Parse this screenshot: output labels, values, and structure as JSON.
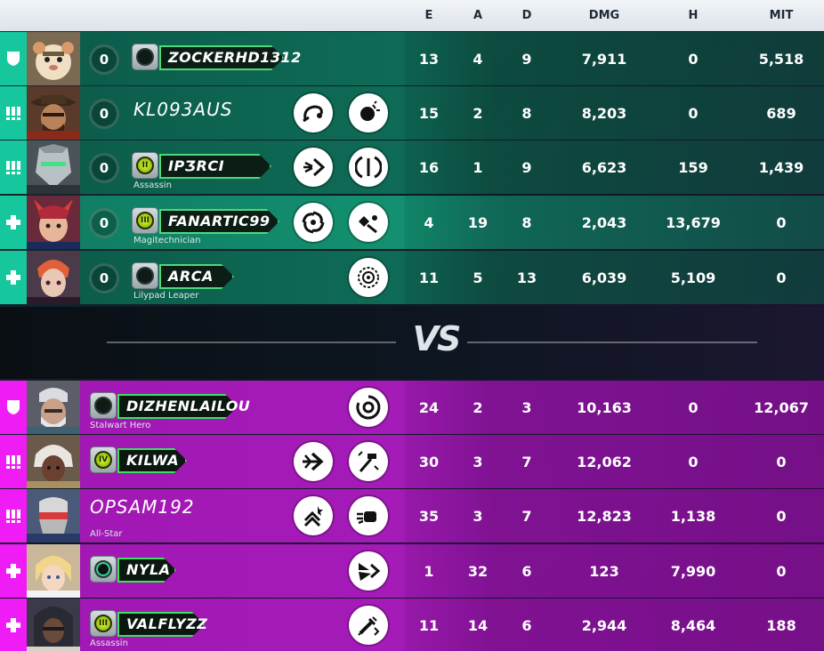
{
  "header": {
    "columns": [
      "E",
      "A",
      "D",
      "DMG",
      "H",
      "MIT"
    ]
  },
  "vs_label": "VS",
  "team_a": [
    {
      "role": "tank",
      "portrait": "hamster-hero-portrait",
      "elims_ring": "0",
      "name": "ZOCKERHD1312",
      "name_style": "nameplate",
      "badge": "empty",
      "title": "",
      "abilities": [],
      "stats": {
        "e": "13",
        "a": "4",
        "d": "9",
        "dmg": "7,911",
        "h": "0",
        "mit": "5,518"
      }
    },
    {
      "role": "damage",
      "portrait": "cowboy-hero-portrait",
      "elims_ring": "0",
      "name": "KL093AUS",
      "name_style": "plain",
      "badge": "",
      "title": "",
      "abilities": [
        "grapple-icon",
        "burst-icon"
      ],
      "stats": {
        "e": "15",
        "a": "2",
        "d": "8",
        "dmg": "8,203",
        "h": "0",
        "mit": "689"
      }
    },
    {
      "role": "damage",
      "portrait": "cyborg-ninja-portrait",
      "elims_ring": "0",
      "name": "IPƷRCI",
      "name_style": "nameplate",
      "badge": "II",
      "title": "Assassin",
      "abilities": [
        "dash-icon",
        "deflect-icon"
      ],
      "stats": {
        "e": "16",
        "a": "1",
        "d": "9",
        "dmg": "6,623",
        "h": "159",
        "mit": "1,439"
      }
    },
    {
      "role": "support",
      "portrait": "fox-mage-portrait",
      "elims_ring": "0",
      "name": "FANARTIC99",
      "name_style": "nameplate",
      "badge": "III",
      "title": "Magitechnician",
      "abilities": [
        "spiral-icon",
        "spirit-icon"
      ],
      "stats": {
        "e": "4",
        "a": "19",
        "d": "8",
        "dmg": "2,043",
        "h": "13,679",
        "mit": "0"
      }
    },
    {
      "role": "support",
      "portrait": "scientist-portrait",
      "elims_ring": "0",
      "name": "ARCA",
      "name_style": "nameplate",
      "badge": "empty",
      "title": "Lilypad Leaper",
      "abilities": [
        "target-orb-icon"
      ],
      "stats": {
        "e": "11",
        "a": "5",
        "d": "13",
        "dmg": "6,039",
        "h": "5,109",
        "mit": "0"
      }
    }
  ],
  "team_b": [
    {
      "role": "tank",
      "portrait": "armored-veteran-portrait",
      "name": "DIZHENLAILOU",
      "name_style": "nameplate",
      "badge": "empty",
      "title": "Stalwart Hero",
      "abilities": [
        "vortex-icon"
      ],
      "stats": {
        "e": "24",
        "a": "2",
        "d": "3",
        "dmg": "10,163",
        "h": "0",
        "mit": "12,067"
      }
    },
    {
      "role": "damage",
      "portrait": "white-hair-hero-portrait",
      "name": "KILWA",
      "name_style": "nameplate",
      "badge": "IV",
      "title": "",
      "abilities": [
        "arrow-dash-icon",
        "hammer-icon"
      ],
      "stats": {
        "e": "30",
        "a": "3",
        "d": "7",
        "dmg": "12,062",
        "h": "0",
        "mit": "0"
      }
    },
    {
      "role": "damage",
      "portrait": "masked-soldier-portrait",
      "name": "OPSAM192",
      "name_style": "plain",
      "badge": "",
      "title": "All-Star",
      "abilities": [
        "sprint-icon",
        "punch-icon"
      ],
      "stats": {
        "e": "35",
        "a": "3",
        "d": "7",
        "dmg": "12,823",
        "h": "1,138",
        "mit": "0"
      }
    },
    {
      "role": "support",
      "portrait": "angel-healer-portrait",
      "name": "NYLA",
      "name_style": "nameplate",
      "badge": "glow",
      "title": "",
      "abilities": [
        "wing-dive-icon"
      ],
      "stats": {
        "e": "1",
        "a": "32",
        "d": "6",
        "dmg": "123",
        "h": "7,990",
        "mit": "0"
      }
    },
    {
      "role": "support",
      "portrait": "hooded-sniper-portrait",
      "name": "VALFLYZZ",
      "name_style": "nameplate",
      "badge": "III",
      "title": "Assassin",
      "abilities": [
        "syringe-icon"
      ],
      "stats": {
        "e": "11",
        "a": "14",
        "d": "6",
        "dmg": "2,944",
        "h": "8,464",
        "mit": "188"
      }
    }
  ],
  "colors": {
    "team_a_role": "#16c79e",
    "team_a_row": "#0e6b56",
    "team_b_role": "#f01cf5",
    "team_b_row": "#a51bb8",
    "nameplate_border": "#4fd97a"
  }
}
